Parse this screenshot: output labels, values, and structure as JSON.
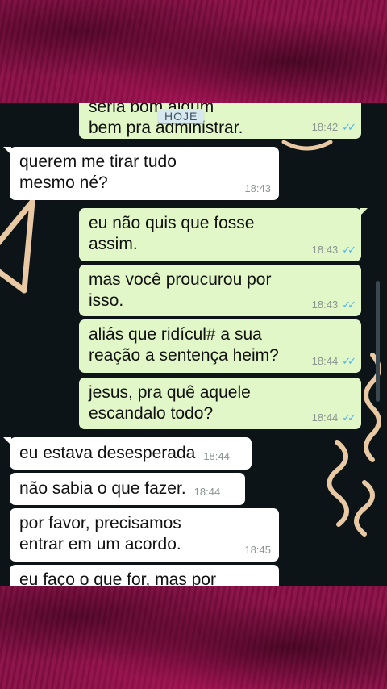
{
  "chat": {
    "date_chip": "HOJE",
    "messages": [
      {
        "text_top": "seria bom algum",
        "text": "bem pra administrar.",
        "time": "18:42",
        "dir": "out",
        "read": true
      },
      {
        "text": "querem me tirar tudo mesmo né?",
        "time": "18:43",
        "dir": "in"
      },
      {
        "text": "eu não quis que fosse assim.",
        "time": "18:43",
        "dir": "out",
        "read": true
      },
      {
        "text": "mas você proucurou por isso.",
        "time": "18:43",
        "dir": "out",
        "read": true
      },
      {
        "text": "aliás que ridícul# a sua reação a sentença heim?",
        "time": "18:44",
        "dir": "out",
        "read": true
      },
      {
        "text": "jesus, pra quê aquele escandalo todo?",
        "time": "18:44",
        "dir": "out",
        "read": true
      },
      {
        "text": "eu estava desesperada",
        "time": "18:44",
        "dir": "in"
      },
      {
        "text": "não sabia o que fazer.",
        "time": "18:44",
        "dir": "in"
      },
      {
        "text": "por favor, precisamos entrar em um acordo.",
        "time": "18:45",
        "dir": "in"
      },
      {
        "text": "eu faço o que for, mas por",
        "dir": "in"
      }
    ]
  },
  "icons": {
    "read_receipt": "double-check-icon"
  },
  "colors": {
    "outgoing": "#e1f7c8",
    "incoming": "#ffffff",
    "ticks": "#4fb6ec",
    "background": "#0c1418",
    "frame": "#8a0f46"
  }
}
